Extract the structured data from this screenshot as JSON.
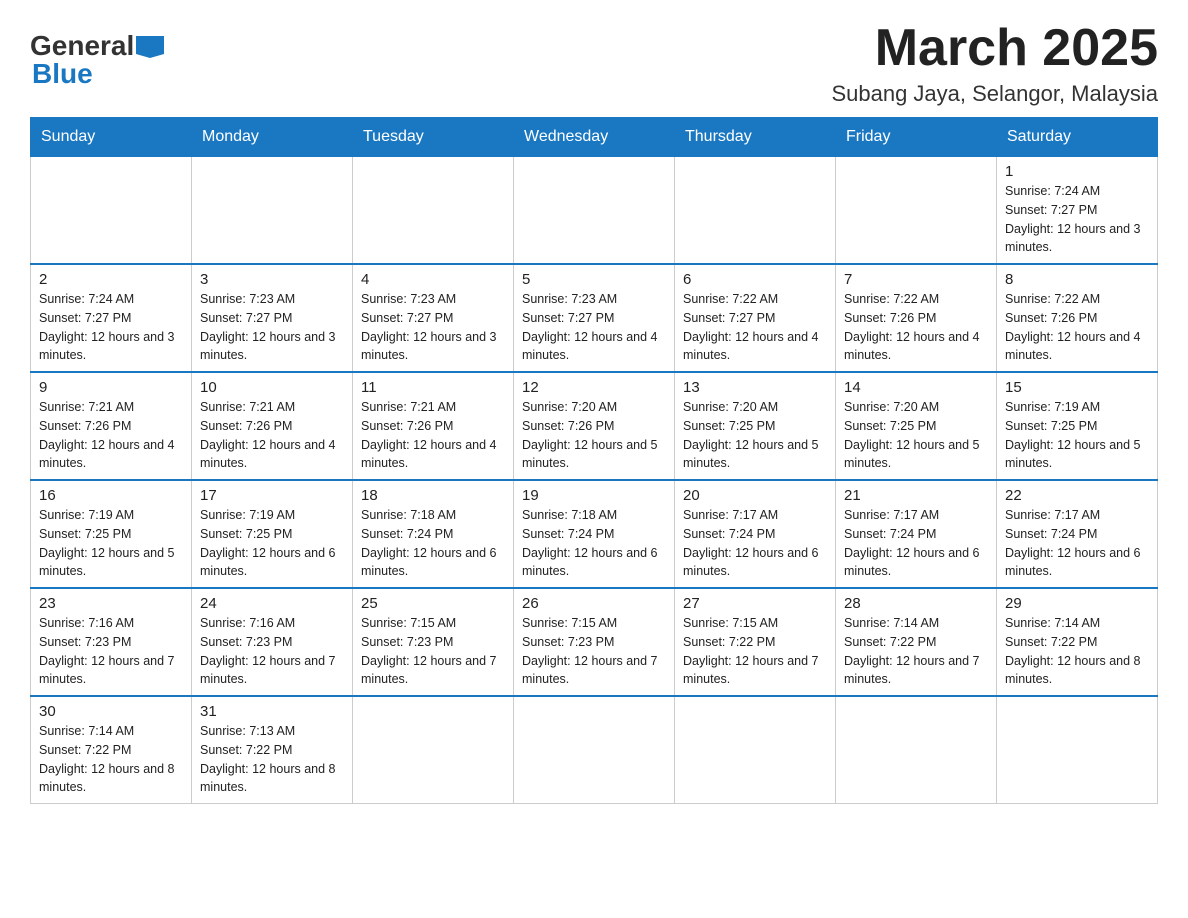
{
  "logo": {
    "general": "General",
    "blue": "Blue"
  },
  "title": "March 2025",
  "location": "Subang Jaya, Selangor, Malaysia",
  "weekdays": [
    "Sunday",
    "Monday",
    "Tuesday",
    "Wednesday",
    "Thursday",
    "Friday",
    "Saturday"
  ],
  "weeks": [
    [
      {
        "day": null
      },
      {
        "day": null
      },
      {
        "day": null
      },
      {
        "day": null
      },
      {
        "day": null
      },
      {
        "day": null
      },
      {
        "day": 1,
        "sunrise": "7:24 AM",
        "sunset": "7:27 PM",
        "daylight": "12 hours and 3 minutes."
      }
    ],
    [
      {
        "day": 2,
        "sunrise": "7:24 AM",
        "sunset": "7:27 PM",
        "daylight": "12 hours and 3 minutes."
      },
      {
        "day": 3,
        "sunrise": "7:23 AM",
        "sunset": "7:27 PM",
        "daylight": "12 hours and 3 minutes."
      },
      {
        "day": 4,
        "sunrise": "7:23 AM",
        "sunset": "7:27 PM",
        "daylight": "12 hours and 3 minutes."
      },
      {
        "day": 5,
        "sunrise": "7:23 AM",
        "sunset": "7:27 PM",
        "daylight": "12 hours and 4 minutes."
      },
      {
        "day": 6,
        "sunrise": "7:22 AM",
        "sunset": "7:27 PM",
        "daylight": "12 hours and 4 minutes."
      },
      {
        "day": 7,
        "sunrise": "7:22 AM",
        "sunset": "7:26 PM",
        "daylight": "12 hours and 4 minutes."
      },
      {
        "day": 8,
        "sunrise": "7:22 AM",
        "sunset": "7:26 PM",
        "daylight": "12 hours and 4 minutes."
      }
    ],
    [
      {
        "day": 9,
        "sunrise": "7:21 AM",
        "sunset": "7:26 PM",
        "daylight": "12 hours and 4 minutes."
      },
      {
        "day": 10,
        "sunrise": "7:21 AM",
        "sunset": "7:26 PM",
        "daylight": "12 hours and 4 minutes."
      },
      {
        "day": 11,
        "sunrise": "7:21 AM",
        "sunset": "7:26 PM",
        "daylight": "12 hours and 4 minutes."
      },
      {
        "day": 12,
        "sunrise": "7:20 AM",
        "sunset": "7:26 PM",
        "daylight": "12 hours and 5 minutes."
      },
      {
        "day": 13,
        "sunrise": "7:20 AM",
        "sunset": "7:25 PM",
        "daylight": "12 hours and 5 minutes."
      },
      {
        "day": 14,
        "sunrise": "7:20 AM",
        "sunset": "7:25 PM",
        "daylight": "12 hours and 5 minutes."
      },
      {
        "day": 15,
        "sunrise": "7:19 AM",
        "sunset": "7:25 PM",
        "daylight": "12 hours and 5 minutes."
      }
    ],
    [
      {
        "day": 16,
        "sunrise": "7:19 AM",
        "sunset": "7:25 PM",
        "daylight": "12 hours and 5 minutes."
      },
      {
        "day": 17,
        "sunrise": "7:19 AM",
        "sunset": "7:25 PM",
        "daylight": "12 hours and 6 minutes."
      },
      {
        "day": 18,
        "sunrise": "7:18 AM",
        "sunset": "7:24 PM",
        "daylight": "12 hours and 6 minutes."
      },
      {
        "day": 19,
        "sunrise": "7:18 AM",
        "sunset": "7:24 PM",
        "daylight": "12 hours and 6 minutes."
      },
      {
        "day": 20,
        "sunrise": "7:17 AM",
        "sunset": "7:24 PM",
        "daylight": "12 hours and 6 minutes."
      },
      {
        "day": 21,
        "sunrise": "7:17 AM",
        "sunset": "7:24 PM",
        "daylight": "12 hours and 6 minutes."
      },
      {
        "day": 22,
        "sunrise": "7:17 AM",
        "sunset": "7:24 PM",
        "daylight": "12 hours and 6 minutes."
      }
    ],
    [
      {
        "day": 23,
        "sunrise": "7:16 AM",
        "sunset": "7:23 PM",
        "daylight": "12 hours and 7 minutes."
      },
      {
        "day": 24,
        "sunrise": "7:16 AM",
        "sunset": "7:23 PM",
        "daylight": "12 hours and 7 minutes."
      },
      {
        "day": 25,
        "sunrise": "7:15 AM",
        "sunset": "7:23 PM",
        "daylight": "12 hours and 7 minutes."
      },
      {
        "day": 26,
        "sunrise": "7:15 AM",
        "sunset": "7:23 PM",
        "daylight": "12 hours and 7 minutes."
      },
      {
        "day": 27,
        "sunrise": "7:15 AM",
        "sunset": "7:22 PM",
        "daylight": "12 hours and 7 minutes."
      },
      {
        "day": 28,
        "sunrise": "7:14 AM",
        "sunset": "7:22 PM",
        "daylight": "12 hours and 7 minutes."
      },
      {
        "day": 29,
        "sunrise": "7:14 AM",
        "sunset": "7:22 PM",
        "daylight": "12 hours and 8 minutes."
      }
    ],
    [
      {
        "day": 30,
        "sunrise": "7:14 AM",
        "sunset": "7:22 PM",
        "daylight": "12 hours and 8 minutes."
      },
      {
        "day": 31,
        "sunrise": "7:13 AM",
        "sunset": "7:22 PM",
        "daylight": "12 hours and 8 minutes."
      },
      {
        "day": null
      },
      {
        "day": null
      },
      {
        "day": null
      },
      {
        "day": null
      },
      {
        "day": null
      }
    ]
  ]
}
